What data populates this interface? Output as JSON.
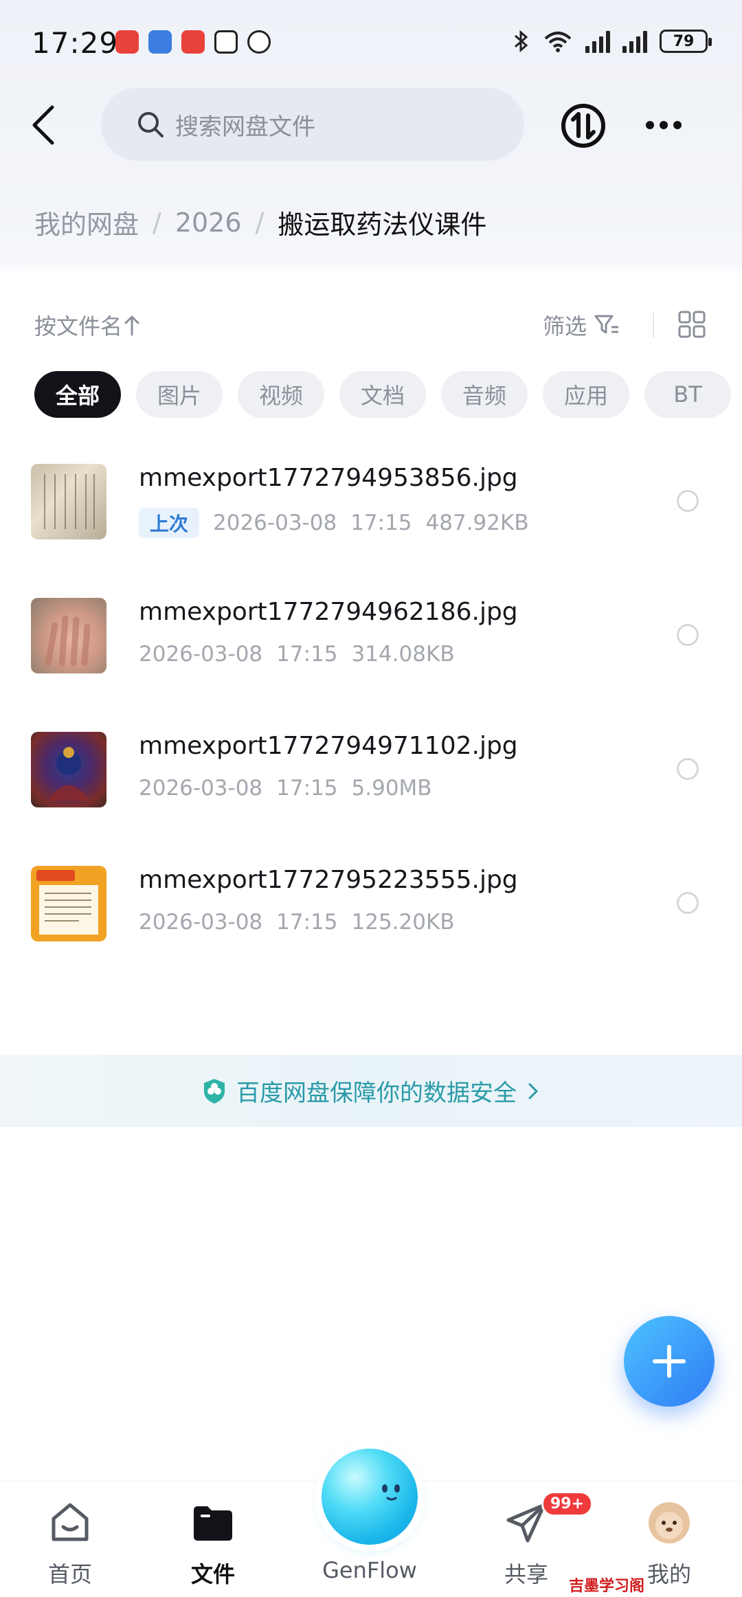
{
  "status_bar": {
    "time": "17:29",
    "battery": "79"
  },
  "header": {
    "search_placeholder": "搜索网盘文件"
  },
  "breadcrumb": {
    "items": [
      "我的网盘",
      "2026"
    ],
    "current": "搬运取药法仪课件"
  },
  "toolbar": {
    "sort_label": "按文件名",
    "filter_label": "筛选"
  },
  "filter_chips": [
    "全部",
    "图片",
    "视频",
    "文档",
    "音频",
    "应用",
    "BT"
  ],
  "files": [
    {
      "name": "mmexport1772794953856.jpg",
      "tag": "上次",
      "date": "2026-03-08",
      "time": "17:15",
      "size": "487.92KB"
    },
    {
      "name": "mmexport1772794962186.jpg",
      "tag": "",
      "date": "2026-03-08",
      "time": "17:15",
      "size": "314.08KB"
    },
    {
      "name": "mmexport1772794971102.jpg",
      "tag": "",
      "date": "2026-03-08",
      "time": "17:15",
      "size": "5.90MB"
    },
    {
      "name": "mmexport1772795223555.jpg",
      "tag": "",
      "date": "2026-03-08",
      "time": "17:15",
      "size": "125.20KB"
    }
  ],
  "safety_banner": "百度网盘保障你的数据安全",
  "bottom_nav": {
    "home": "首页",
    "files": "文件",
    "genflow": "GenFlow",
    "share": "共享",
    "mine": "我的",
    "share_badge": "99+"
  },
  "watermark": "吉墨学习阁 jimoxxg.com",
  "colors": {
    "accent": "#2f7cf5",
    "active_chip": "#111318",
    "safety_text": "#2a9aa8",
    "badge": "#ef3b3b"
  }
}
